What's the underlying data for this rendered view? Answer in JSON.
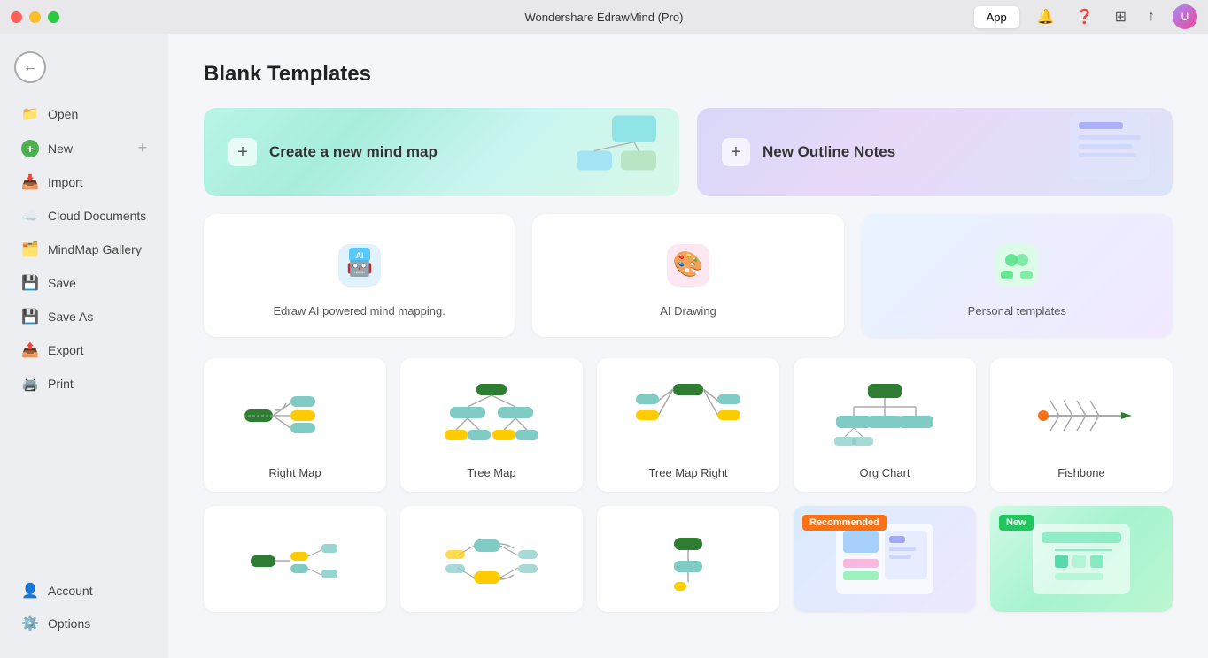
{
  "titlebar": {
    "title": "Wondershare EdrawMind (Pro)",
    "app_btn": "App"
  },
  "sidebar": {
    "back_label": "←",
    "items": [
      {
        "id": "open",
        "label": "Open",
        "icon": "📁"
      },
      {
        "id": "new",
        "label": "New",
        "icon": "✨"
      },
      {
        "id": "import",
        "label": "Import",
        "icon": "📥"
      },
      {
        "id": "cloud",
        "label": "Cloud Documents",
        "icon": "☁️"
      },
      {
        "id": "gallery",
        "label": "MindMap Gallery",
        "icon": "🗂️"
      },
      {
        "id": "save",
        "label": "Save",
        "icon": "💾"
      },
      {
        "id": "saveas",
        "label": "Save As",
        "icon": "💾"
      },
      {
        "id": "export",
        "label": "Export",
        "icon": "📤"
      },
      {
        "id": "print",
        "label": "Print",
        "icon": "🖨️"
      }
    ],
    "bottom_items": [
      {
        "id": "account",
        "label": "Account",
        "icon": "👤"
      },
      {
        "id": "options",
        "label": "Options",
        "icon": "⚙️"
      }
    ]
  },
  "content": {
    "page_title": "Blank Templates",
    "hero_cards": [
      {
        "id": "new-mind-map",
        "label": "Create a new mind map",
        "plus": "+"
      },
      {
        "id": "new-outline",
        "label": "New Outline Notes",
        "plus": "+"
      }
    ],
    "feature_cards": [
      {
        "id": "ai-mind",
        "label": "Edraw AI powered mind mapping.",
        "icon": "🤖"
      },
      {
        "id": "ai-drawing",
        "label": "AI Drawing",
        "icon": "🎨"
      },
      {
        "id": "personal",
        "label": "Personal templates",
        "icon": "👥"
      }
    ],
    "templates": [
      {
        "id": "right-map",
        "label": "Right Map"
      },
      {
        "id": "tree-map",
        "label": "Tree Map"
      },
      {
        "id": "tree-map-right",
        "label": "Tree Map Right"
      },
      {
        "id": "org-chart",
        "label": "Org Chart"
      },
      {
        "id": "fishbone",
        "label": "Fishbone"
      }
    ],
    "bottom_templates": [
      {
        "id": "bt1",
        "label": "",
        "badge": null
      },
      {
        "id": "bt2",
        "label": "",
        "badge": null
      },
      {
        "id": "bt3",
        "label": "",
        "badge": null
      },
      {
        "id": "bt4",
        "label": "",
        "badge": "Recommended"
      },
      {
        "id": "bt5",
        "label": "",
        "badge": "New"
      }
    ]
  }
}
